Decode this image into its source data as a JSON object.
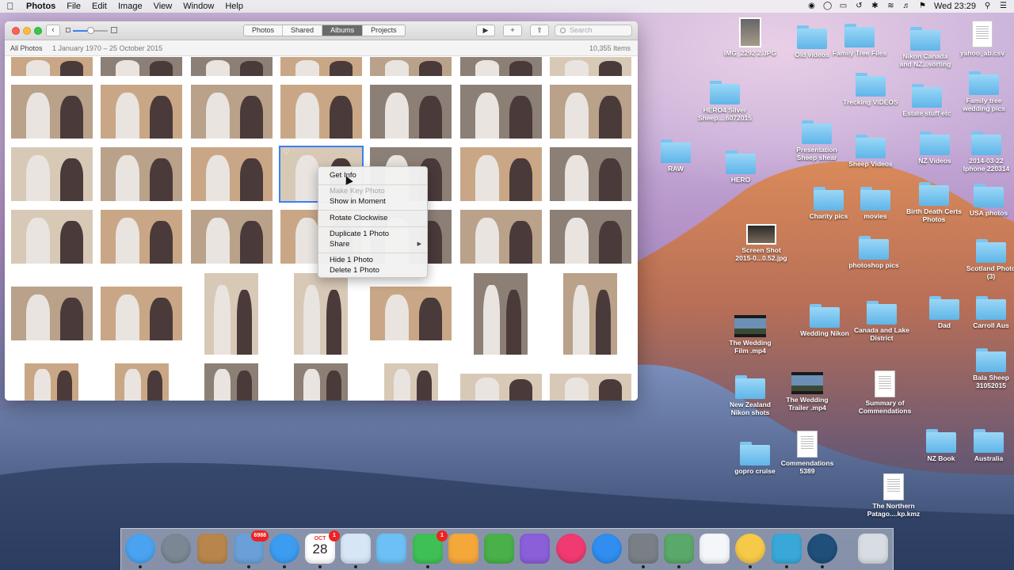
{
  "menubar": {
    "app": "Photos",
    "items": [
      "File",
      "Edit",
      "Image",
      "View",
      "Window",
      "Help"
    ],
    "clock": "Wed 23:29"
  },
  "window": {
    "tabs": [
      {
        "label": "Photos",
        "active": false
      },
      {
        "label": "Shared",
        "active": false
      },
      {
        "label": "Albums",
        "active": true
      },
      {
        "label": "Projects",
        "active": false
      }
    ],
    "search_placeholder": "Search",
    "info": {
      "title": "All Photos",
      "date_range": "1 January 1970 – 25 October 2015",
      "count": "10,355 Items"
    }
  },
  "context_menu": {
    "items": [
      {
        "label": "Get Info",
        "enabled": true
      },
      {
        "label": "Make Key Photo",
        "enabled": false
      },
      {
        "label": "Show in Moment",
        "enabled": true
      },
      {
        "label": "Rotate Clockwise",
        "enabled": true
      },
      {
        "label": "Duplicate 1 Photo",
        "enabled": true
      },
      {
        "label": "Share",
        "enabled": true,
        "submenu": true
      },
      {
        "label": "Hide 1 Photo",
        "enabled": true
      },
      {
        "label": "Delete 1 Photo",
        "enabled": true
      }
    ]
  },
  "desktop_icons": [
    {
      "label": "IMG_2292 2.JPG",
      "kind": "jpg"
    },
    {
      "label": "Old videos",
      "kind": "folder"
    },
    {
      "label": "Family Tree Files",
      "kind": "folder"
    },
    {
      "label": "Nikon Canada and NZ...sorting",
      "kind": "folder"
    },
    {
      "label": "yahoo_ab.csv",
      "kind": "doc"
    },
    {
      "label": "HERO4 Silver Sheep....6072015",
      "kind": "folder"
    },
    {
      "label": "Trecking VIDEOS",
      "kind": "folder"
    },
    {
      "label": "Estate stuff etc",
      "kind": "folder"
    },
    {
      "label": "Family tree wedding pics",
      "kind": "folder"
    },
    {
      "label": "RAW",
      "kind": "folder"
    },
    {
      "label": "HERO",
      "kind": "folder"
    },
    {
      "label": "Presentation Sheep shear",
      "kind": "folder"
    },
    {
      "label": "Sheep Videos",
      "kind": "folder"
    },
    {
      "label": "NZ Videos",
      "kind": "folder"
    },
    {
      "label": "2014-03-22 Iphone 220314",
      "kind": "folder"
    },
    {
      "label": "Charity pics",
      "kind": "folder"
    },
    {
      "label": "movies",
      "kind": "folder"
    },
    {
      "label": "Birth Death Certs Photos",
      "kind": "folder"
    },
    {
      "label": "USA photos",
      "kind": "folder"
    },
    {
      "label": "Screen Shot 2015-0...0.52.jpg",
      "kind": "thumb"
    },
    {
      "label": "photoshop pics",
      "kind": "folder"
    },
    {
      "label": "Scotland Photo (3)",
      "kind": "folder"
    },
    {
      "label": "The Wedding Film .mp4",
      "kind": "video"
    },
    {
      "label": "Wedding Nikon",
      "kind": "folder"
    },
    {
      "label": "Canada and Lake District",
      "kind": "folder"
    },
    {
      "label": "Dad",
      "kind": "folder"
    },
    {
      "label": "Carroll Aus",
      "kind": "folder"
    },
    {
      "label": "New Zealand Nikon shots",
      "kind": "folder"
    },
    {
      "label": "The Wedding Trailer .mp4",
      "kind": "video"
    },
    {
      "label": "Summary of Commendations",
      "kind": "doc"
    },
    {
      "label": "Bala Sheep 31052015",
      "kind": "folder"
    },
    {
      "label": "gopro cruise",
      "kind": "folder"
    },
    {
      "label": "Commendations 5389",
      "kind": "doc"
    },
    {
      "label": "NZ Book",
      "kind": "folder"
    },
    {
      "label": "Australia",
      "kind": "folder"
    },
    {
      "label": "The Northern Patago....kp.kmz",
      "kind": "doc"
    }
  ],
  "dock": {
    "apps": [
      {
        "icon": "finder-icon",
        "color": "#4aa3f0"
      },
      {
        "icon": "launchpad-icon",
        "color": "#7c8793"
      },
      {
        "icon": "contacts-icon",
        "color": "#b8864d"
      },
      {
        "icon": "mail-icon",
        "color": "#6aa0d8",
        "badge": "6988"
      },
      {
        "icon": "safari-icon",
        "color": "#3b9cf0"
      },
      {
        "icon": "calendar-icon",
        "color": "#ffffff",
        "badge": "1",
        "text_top": "OCT",
        "text_main": "28"
      },
      {
        "icon": "preview-icon",
        "color": "#d7e6f5"
      },
      {
        "icon": "messages-icon",
        "color": "#6dc0f5"
      },
      {
        "icon": "facetime-icon",
        "color": "#3fc055",
        "badge": "1"
      },
      {
        "icon": "pages-icon",
        "color": "#f5a83a"
      },
      {
        "icon": "numbers-icon",
        "color": "#4ab04a"
      },
      {
        "icon": "imovie-icon",
        "color": "#8a5fd8"
      },
      {
        "icon": "itunes-icon",
        "color": "#f03a72"
      },
      {
        "icon": "app-store-icon",
        "color": "#2f8ef0"
      },
      {
        "icon": "system-preferences-icon",
        "color": "#7a7f86"
      },
      {
        "icon": "photos-maps-icon",
        "color": "#5aa86a"
      },
      {
        "icon": "icloud-icon",
        "color": "#f4f6fa"
      },
      {
        "icon": "photos-icon",
        "color": "#f7c948"
      },
      {
        "icon": "app-icon",
        "color": "#39a8d8"
      },
      {
        "icon": "quicktime-icon",
        "color": "#1f4f7a"
      },
      {
        "icon": "trash-icon",
        "color": "#d8dde3"
      }
    ]
  }
}
